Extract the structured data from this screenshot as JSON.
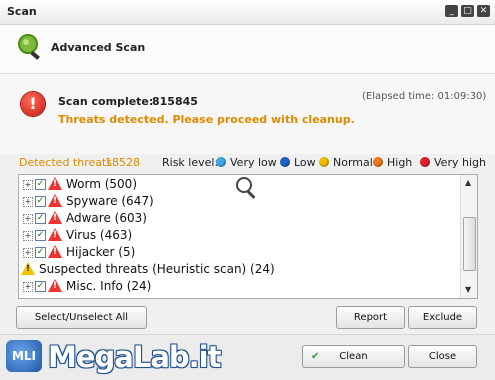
{
  "window": {
    "title": "Scan"
  },
  "window_controls": [
    "_",
    "□",
    "✕"
  ],
  "header": {
    "title": "Advanced Scan"
  },
  "status": {
    "scan_complete_label": "Scan complete:",
    "scan_complete_count": "815845",
    "elapsed": "(Elapsed time: 01:09:30)",
    "message": "Threats detected. Please proceed with cleanup."
  },
  "threats": {
    "detected_label": "Detected threats:",
    "detected_count": "18528",
    "risk_label": "Risk level:",
    "levels": [
      {
        "label": "Very low",
        "color": "#3fa9e8"
      },
      {
        "label": "Low",
        "color": "#1f63c9"
      },
      {
        "label": "Normal",
        "color": "#f0c000"
      },
      {
        "label": "High",
        "color": "#f07a1e"
      },
      {
        "label": "Very high",
        "color": "#e0222a"
      }
    ]
  },
  "list": {
    "items": [
      {
        "label": "Worm (500)",
        "checked": true
      },
      {
        "label": "Spyware (647)",
        "checked": true
      },
      {
        "label": "Adware (603)",
        "checked": true
      },
      {
        "label": "Virus (463)",
        "checked": true
      },
      {
        "label": "Hijacker (5)",
        "checked": true
      },
      {
        "label": "Suspected threats (Heuristic scan) (24)",
        "checked": false
      },
      {
        "label": "Misc. Info (24)",
        "checked": true
      }
    ]
  },
  "buttons": {
    "select_all": "Select/Unselect All",
    "report": "Report",
    "exclude": "Exclude",
    "clean": "Clean",
    "close": "Close"
  },
  "watermark": {
    "text": "MegaLab.it",
    "badge": "MLI"
  },
  "colors": {
    "accent_orange": "#e08a00",
    "clean_check": "#2e9e2e"
  }
}
